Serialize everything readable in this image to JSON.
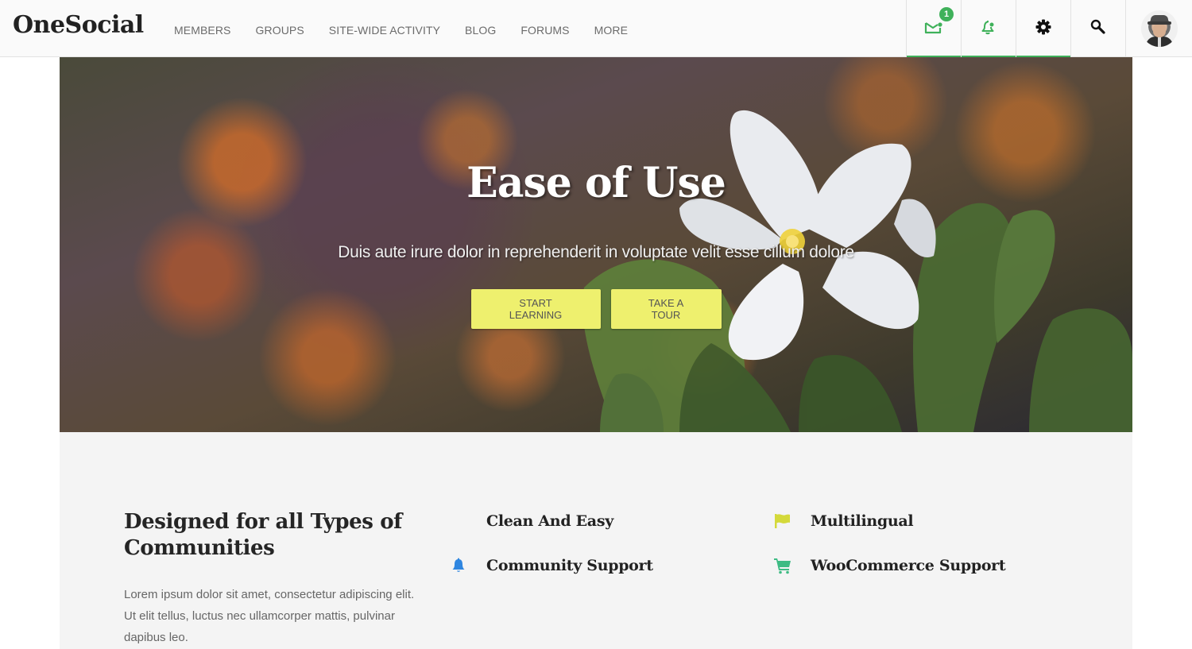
{
  "header": {
    "logo": "OneSocial",
    "nav": [
      {
        "label": "MEMBERS"
      },
      {
        "label": "GROUPS"
      },
      {
        "label": "SITE-WIDE ACTIVITY"
      },
      {
        "label": "BLOG"
      },
      {
        "label": "FORUMS"
      },
      {
        "label": "MORE"
      }
    ],
    "toolbar": {
      "messages": {
        "icon": "envelope-icon",
        "badge_count": "1"
      },
      "notifications": {
        "icon": "bell-icon"
      },
      "settings": {
        "icon": "gear-icon"
      },
      "search": {
        "icon": "search-icon"
      },
      "profile": {
        "icon": "avatar"
      }
    },
    "accent_color": "#3fb15a"
  },
  "hero": {
    "title": "Ease of Use",
    "subtitle": "Duis aute irure dolor in reprehenderit in voluptate velit esse cillum dolore",
    "buttons": [
      {
        "label": "START LEARNING"
      },
      {
        "label": "TAKE A TOUR"
      }
    ],
    "button_color": "#eef06e"
  },
  "features": {
    "title": "Designed for all Types of Communities",
    "description": "Lorem ipsum dolor sit amet, consectetur adipiscing elit. Ut elit tellus, luctus nec ullamcorper mattis, pulvinar dapibus leo.",
    "items": [
      {
        "label": "Clean And Easy",
        "icon": "none"
      },
      {
        "label": "Community Support",
        "icon": "bell-icon",
        "color": "#2f86e0"
      },
      {
        "label": "Multilingual",
        "icon": "flag-icon",
        "color": "#d4d93a"
      },
      {
        "label": "WooCommerce Support",
        "icon": "cart-icon",
        "color": "#3dbb83"
      }
    ]
  }
}
